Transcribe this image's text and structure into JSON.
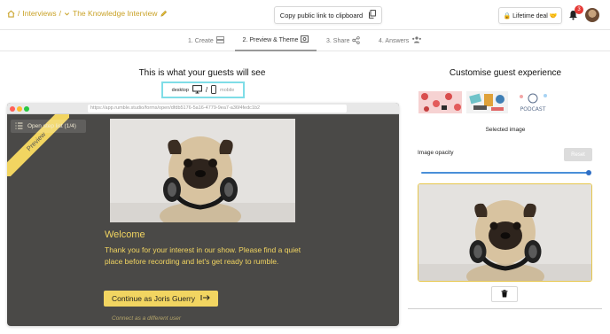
{
  "breadcrumb": {
    "home_icon": "home-icon",
    "sep1": "/",
    "interviews": "Interviews",
    "sep2": "/",
    "interview_name": "The Knowledge Interview",
    "edit_icon": "pencil-icon"
  },
  "toolbar": {
    "copy_link_label": "Copy public link to clipboard",
    "copy_icon": "copy-icon",
    "lifetime_deal_label": "🔒 Lifetime deal 🤝",
    "notification_count": "3"
  },
  "steps": [
    {
      "label": "1. Create",
      "icon": "layout-icon"
    },
    {
      "label": "2. Preview & Theme",
      "icon": "preview-icon"
    },
    {
      "label": "3. Share",
      "icon": "share-icon"
    },
    {
      "label": "4. Answers",
      "icon": "users-icon"
    }
  ],
  "preview": {
    "title": "This is what your guests will see",
    "desktop_label": "desktop",
    "separator": "/",
    "mobile_label": "mobile",
    "url": "https://app.rumble.studio/forms/open/dfdb5176-5a16-4779-9ea7-a36f4fedc1b2",
    "open_step_list": "Open step list (1/4)",
    "ribbon": "Preview",
    "welcome_heading": "Welcome",
    "welcome_body": "Thank you for your interest in our show. Please find a quiet place before recording and let's get ready to rumble.",
    "continue_label": "Continue as Joris Guerry",
    "different_user": "Connect as a different user"
  },
  "customise": {
    "title": "Customise guest experience",
    "thumb_podcast_text": "PODCAST",
    "selected_image_label": "Selected image",
    "opacity_label": "Image opacity",
    "opacity_value": 1.0,
    "reset_label": "Reset"
  },
  "colors": {
    "accent": "#f2d561",
    "preview_bg": "#4a4947",
    "toggle_border": "#7fdde7",
    "badge": "#e53935",
    "slider": "#4a8fd8"
  }
}
